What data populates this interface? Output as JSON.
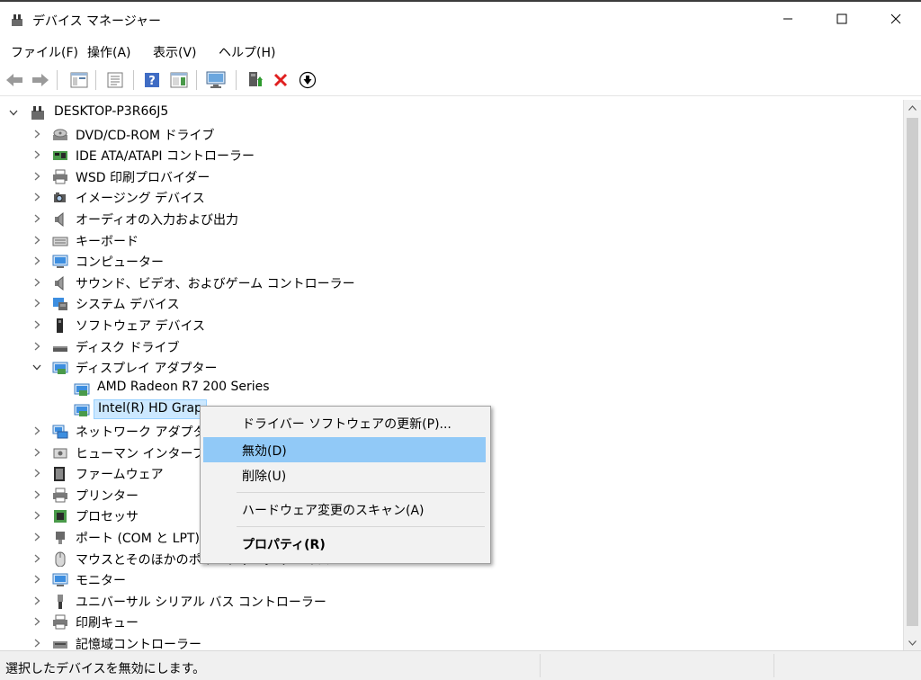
{
  "window": {
    "title": "デバイス マネージャー",
    "controls": {
      "minimize": "minimize",
      "maximize": "maximize",
      "close": "close"
    }
  },
  "menu": [
    "ファイル(F)",
    "操作(A)",
    "表示(V)",
    "ヘルプ(H)"
  ],
  "toolbar": [
    "back-arrow-icon",
    "forward-arrow-icon",
    "properties-sheet-icon",
    "devices-list-icon",
    "help-icon",
    "action-pane-icon",
    "monitor-scan-icon",
    "update-driver-icon",
    "uninstall-x-icon",
    "disable-device-icon"
  ],
  "tree": {
    "root": "DESKTOP-P3R66J5",
    "items": [
      {
        "label": "DVD/CD-ROM ドライブ",
        "icon": "dvd-drive-icon"
      },
      {
        "label": "IDE ATA/ATAPI コントローラー",
        "icon": "ide-controller-icon"
      },
      {
        "label": "WSD 印刷プロバイダー",
        "icon": "printer-provider-icon"
      },
      {
        "label": "イメージング デバイス",
        "icon": "camera-icon"
      },
      {
        "label": "オーディオの入力および出力",
        "icon": "speaker-icon"
      },
      {
        "label": "キーボード",
        "icon": "keyboard-icon"
      },
      {
        "label": "コンピューター",
        "icon": "computer-icon"
      },
      {
        "label": "サウンド、ビデオ、およびゲーム コントローラー",
        "icon": "speaker-icon"
      },
      {
        "label": "システム デバイス",
        "icon": "system-device-icon"
      },
      {
        "label": "ソフトウェア デバイス",
        "icon": "software-device-icon"
      },
      {
        "label": "ディスク ドライブ",
        "icon": "disk-drive-icon"
      },
      {
        "label": "ディスプレイ アダプター",
        "icon": "display-adapter-icon",
        "expanded": true
      },
      {
        "label": "AMD Radeon R7 200 Series",
        "icon": "display-adapter-icon",
        "child": true
      },
      {
        "label": "Intel(R) HD Grap",
        "icon": "display-adapter-icon",
        "child": true,
        "selected": true
      },
      {
        "label": "ネットワーク アダプター",
        "icon": "network-adapter-icon"
      },
      {
        "label": "ヒューマン インターフェイ",
        "icon": "hid-icon"
      },
      {
        "label": "ファームウェア",
        "icon": "firmware-icon"
      },
      {
        "label": "プリンター",
        "icon": "printer-icon"
      },
      {
        "label": "プロセッサ",
        "icon": "processor-icon"
      },
      {
        "label": "ポート (COM と LPT)",
        "icon": "port-icon"
      },
      {
        "label": "マウスとそのほかのポインティング デバイス",
        "icon": "mouse-icon"
      },
      {
        "label": "モニター",
        "icon": "monitor-icon"
      },
      {
        "label": "ユニバーサル シリアル バス コントローラー",
        "icon": "usb-icon"
      },
      {
        "label": "印刷キュー",
        "icon": "print-queue-icon"
      },
      {
        "label": "記憶域コントローラー",
        "icon": "storage-controller-icon"
      }
    ]
  },
  "context_menu": [
    {
      "label": "ドライバー ソフトウェアの更新(P)..."
    },
    {
      "label": "無効(D)",
      "highlighted": true
    },
    {
      "label": "削除(U)"
    },
    {
      "label": "ハードウェア変更のスキャン(A)"
    },
    {
      "label": "プロパティ(R)",
      "bold": true
    }
  ],
  "status": {
    "text": "選択したデバイスを無効にします。"
  },
  "colors": {
    "selection": "#cce8ff",
    "menu_highlight": "#91c9f7",
    "menu_bg": "#f2f2f2"
  }
}
